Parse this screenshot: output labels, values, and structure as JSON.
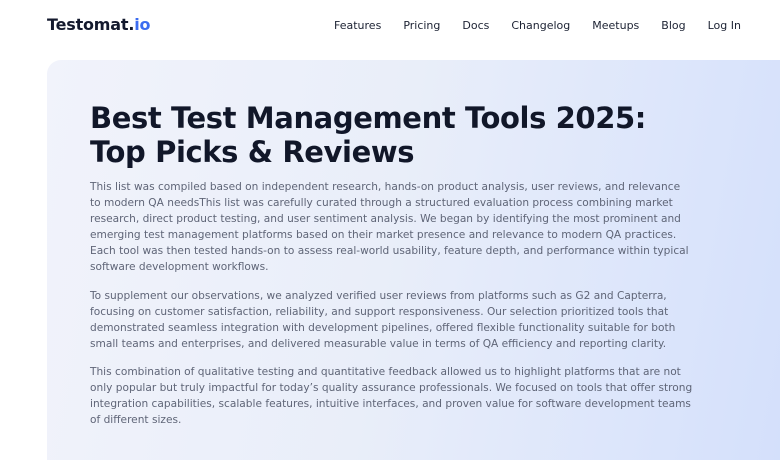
{
  "header": {
    "logo": {
      "text_main": "Testomat.",
      "text_accent": "io"
    },
    "nav": [
      "Features",
      "Pricing",
      "Docs",
      "Changelog",
      "Meetups",
      "Blog",
      "Log In"
    ]
  },
  "article": {
    "title_line1": "Best Test Management Tools 2025:",
    "title_line2": "Top Picks & Reviews",
    "paragraphs": [
      "This list was compiled based on independent research, hands-on product analysis, user reviews, and relevance to modern QA needsThis list was carefully curated through a structured evaluation process combining market research, direct product testing, and user sentiment analysis. We began by identifying the most prominent and emerging test management platforms based on their market presence and relevance to modern QA practices. Each tool was then tested hands-on to assess real-world usability, feature depth, and performance within typical software development workflows.",
      "To supplement our observations, we analyzed verified user reviews from platforms such as G2 and Capterra, focusing on customer satisfaction, reliability, and support responsiveness. Our selection prioritized tools that demonstrated seamless integration with development pipelines, offered flexible functionality suitable for both small teams and enterprises, and delivered measurable value in terms of QA efficiency and reporting clarity.",
      "This combination of qualitative testing and quantitative feedback allowed us to highlight platforms that are not only popular but truly impactful for today’s quality assurance professionals. We focused on tools that offer strong integration capabilities, scalable features, intuitive interfaces, and proven value for software development teams of different sizes."
    ]
  },
  "colors": {
    "accent": "#3b6cf0",
    "title": "#111729",
    "body_text": "#5f6577"
  }
}
